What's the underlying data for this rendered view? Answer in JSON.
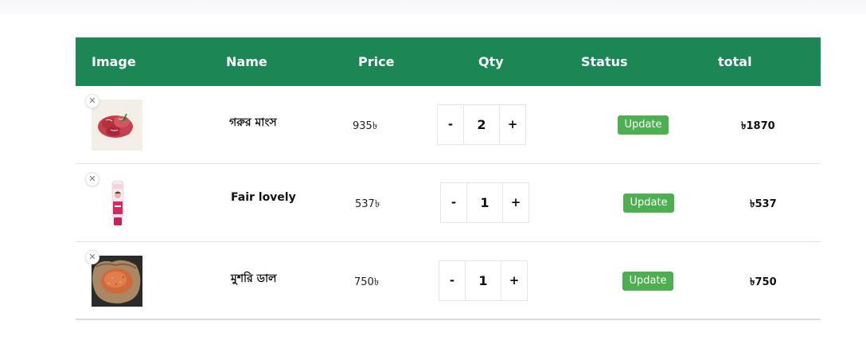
{
  "colors": {
    "header_bg": "#1a8754",
    "header_text": "#ffffff",
    "update_button": "#4caf50"
  },
  "table": {
    "headers": {
      "image": "Image",
      "name": "Name",
      "price": "Price",
      "qty": "Qty",
      "status": "Status",
      "total": "total"
    },
    "rows": [
      {
        "remove": "✕",
        "image_icon": "beef-meat-image",
        "name": "গরুর মাংস",
        "price": "935৳",
        "minus": "-",
        "qty": "2",
        "plus": "+",
        "update": "Update",
        "total": "৳1870"
      },
      {
        "remove": "✕",
        "image_icon": "fair-lovely-cream-image",
        "name": "Fair lovely",
        "price": "537৳",
        "minus": "-",
        "qty": "1",
        "plus": "+",
        "update": "Update",
        "total": "৳537"
      },
      {
        "remove": "✕",
        "image_icon": "red-lentil-sack-image",
        "name": "মুশরি ডাল",
        "price": "750৳",
        "minus": "-",
        "qty": "1",
        "plus": "+",
        "update": "Update",
        "total": "৳750"
      }
    ]
  }
}
